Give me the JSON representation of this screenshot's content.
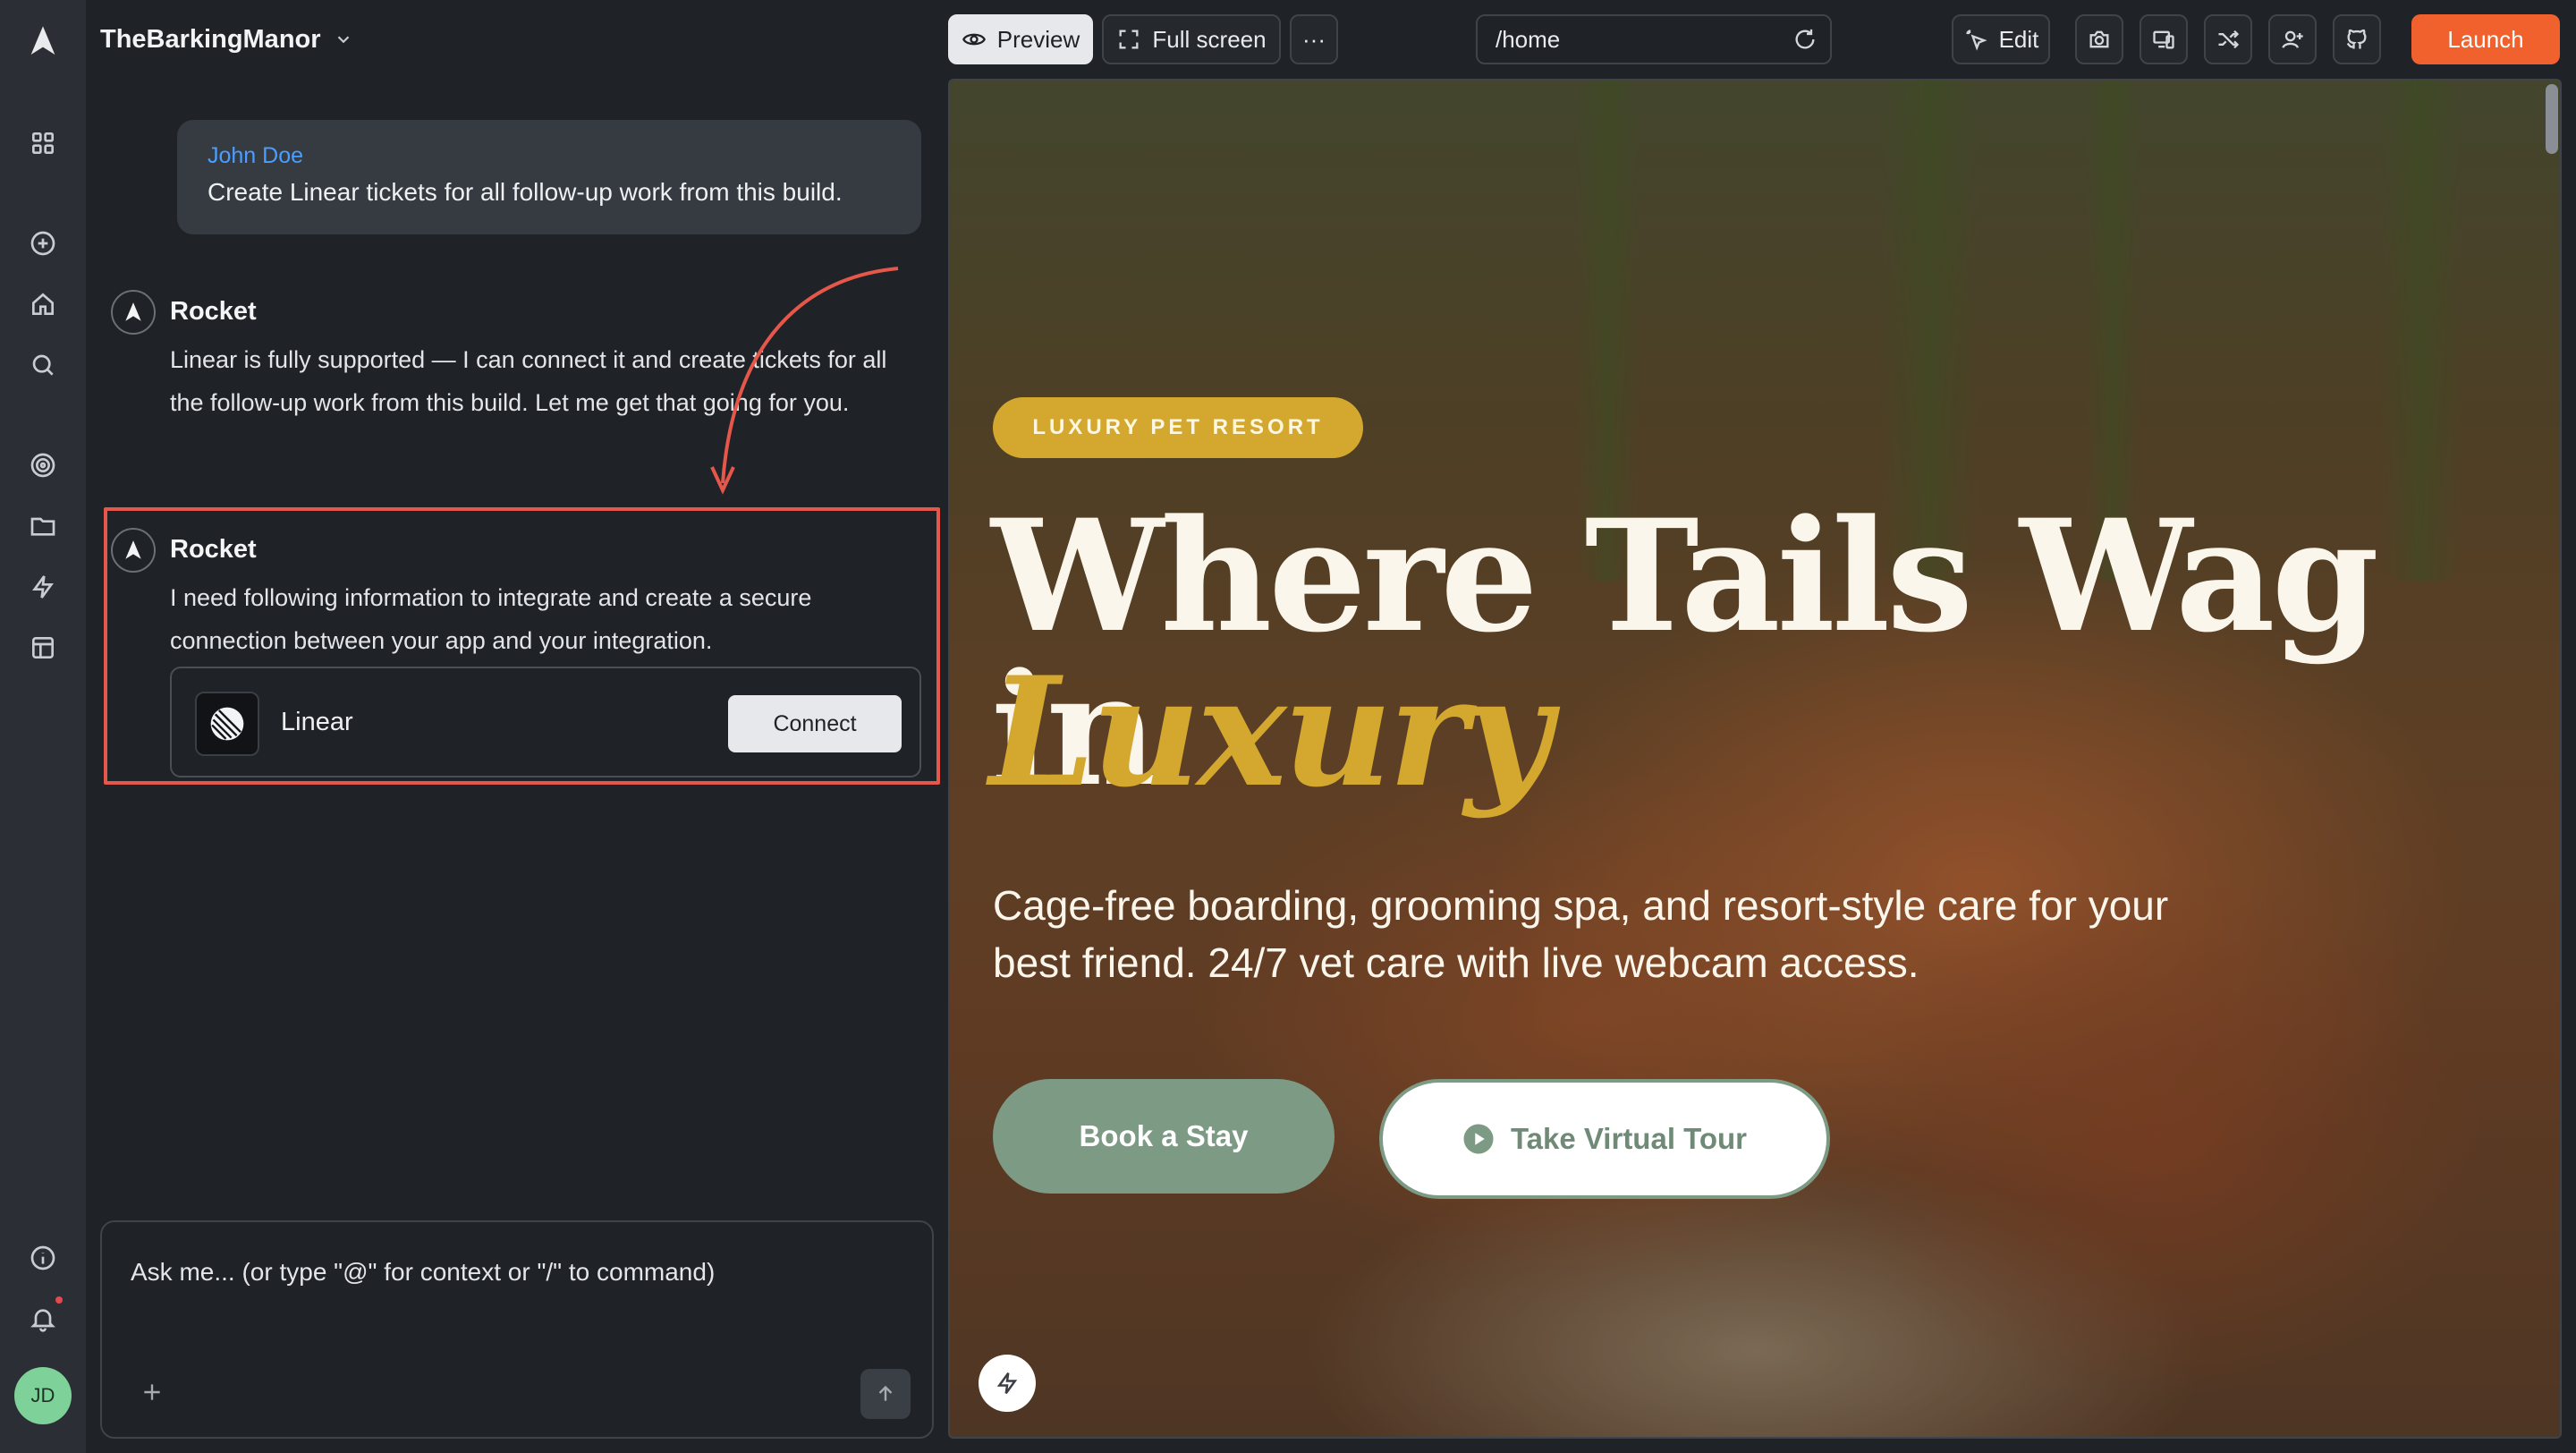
{
  "project": {
    "name": "TheBarkingManor"
  },
  "rail": {
    "avatar_initials": "JD"
  },
  "chat": {
    "user_message": {
      "author": "John Doe",
      "text": "Create Linear tickets for all follow-up work from this build."
    },
    "assistant_messages": [
      {
        "author": "Rocket",
        "text": "Linear is fully supported — I can connect it and create tickets for all the follow-up work from this build. Let me get that going for you."
      },
      {
        "author": "Rocket",
        "text": "I need following information to integrate and create a secure connection between your app and your integration."
      }
    ],
    "integration": {
      "name": "Linear",
      "action_label": "Connect"
    },
    "composer": {
      "placeholder": "Ask me... (or type \"@\" for context or \"/\" to command)"
    }
  },
  "toolbar": {
    "preview_label": "Preview",
    "fullscreen_label": "Full screen",
    "more_label": "···",
    "url": "/home",
    "edit_label": "Edit",
    "launch_label": "Launch"
  },
  "preview": {
    "badge": "LUXURY PET RESORT",
    "title": "Where Tails Wag in",
    "title_accent": "Luxury",
    "subtitle": "Cage-free boarding, grooming spa, and resort-style care for your best friend. 24/7 vet care with live webcam access.",
    "primary_cta": "Book a Stay",
    "secondary_cta": "Take Virtual Tour"
  },
  "colors": {
    "accent": "#f0612d",
    "gold": "#d4a82f",
    "sage": "#7c9a84",
    "highlight": "#e5574a",
    "link": "#4a9eff"
  }
}
